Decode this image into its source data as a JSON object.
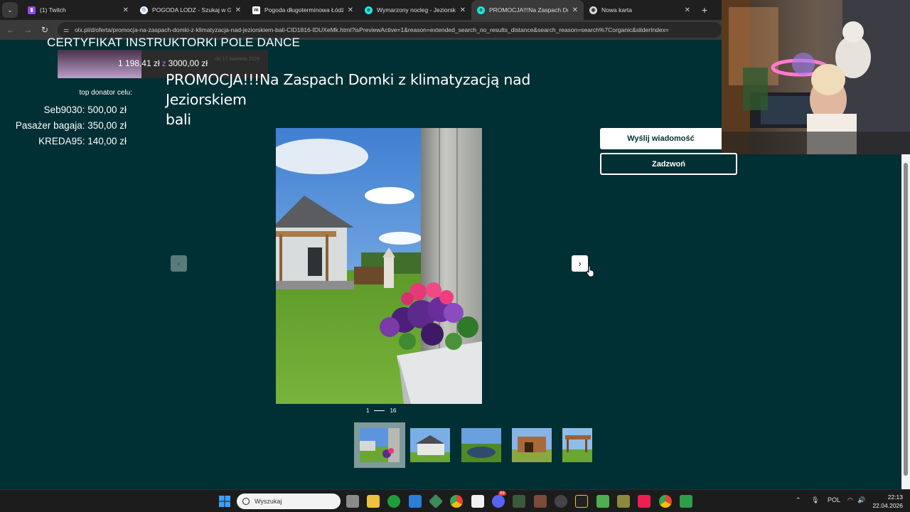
{
  "browser": {
    "tabs": [
      {
        "title": "(1) Twitch",
        "favicon": "twitch-icon",
        "active": false
      },
      {
        "title": "POGODA LODZ - Szukaj w Goo",
        "favicon": "google-icon",
        "active": false
      },
      {
        "title": "Pogoda długoterminowa Łódź",
        "favicon": "weather-site-icon",
        "active": false
      },
      {
        "title": "Wymarzony nocleg - Jeziorsko",
        "favicon": "olx-icon",
        "active": false
      },
      {
        "title": "PROMOCJA!!!Na Zaspach Domk",
        "favicon": "olx-icon",
        "active": true
      },
      {
        "title": "Nowa karta",
        "favicon": "chrome-icon",
        "active": false
      }
    ],
    "url": "olx.pl/d/oferta/promocja-na-zaspach-domki-z-klimatyzacja-nad-jeziorskiem-bali-CID1816-IDUXeMk.html?isPreviewActive=1&reason=extended_search_no_results_distance&search_reason=search%7Corganic&sliderIndex="
  },
  "overlay": {
    "goal_title": "CERTYFIKAT INSTRUKTORKI POLE DANCE",
    "goal_current": "1 198,41 zł",
    "goal_separator": "z",
    "goal_target": "3000,00 zł",
    "goal_fraction": 0.3995,
    "goal_date_ghost": "do 17 kwietnia 2026",
    "top_donor_label": "top donator celu:",
    "donors": [
      {
        "text": "Seb9030: 500,00 zł"
      },
      {
        "text": "Pasażer bagaja: 350,00 zł"
      },
      {
        "text": "KREDA95: 140,00 zł"
      }
    ]
  },
  "listing": {
    "title_line1": "PROMOCJA!!!Na Zaspach Domki z klimatyzacją nad Jeziorskiem",
    "title_line2": "bali",
    "send_message_label": "Wyślij wiadomość",
    "call_label": "Zadzwoń",
    "gallery": {
      "current": "1",
      "total": "16"
    }
  },
  "taskbar": {
    "search_placeholder": "Wyszukaj",
    "language": "POL",
    "time": "22:13",
    "date": "22.04.2026",
    "discord_badge": "99"
  },
  "colors": {
    "page_bg": "#002f34",
    "accent_purple": "#c070f0",
    "button_white": "#ffffff"
  }
}
